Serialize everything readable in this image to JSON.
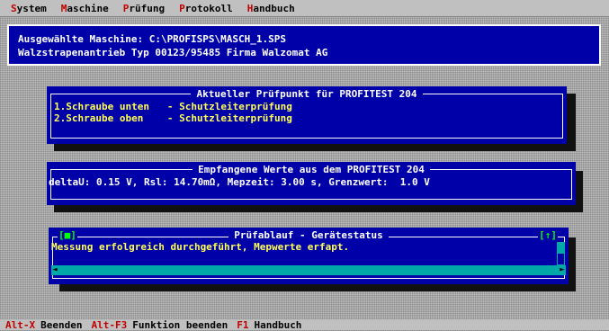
{
  "menu": [
    {
      "hot": "S",
      "rest": "ystem"
    },
    {
      "hot": "M",
      "rest": "aschine"
    },
    {
      "hot": "P",
      "rest": "rüfung"
    },
    {
      "hot": "P",
      "rest": "rotokoll"
    },
    {
      "hot": "H",
      "rest": "andbuch"
    }
  ],
  "machine": {
    "line1": "Ausgewählte Maschine: C:\\PROFISPS\\MASCH_1.SPS",
    "line2": "Walzstrapenantrieb Typ 00123/95485 Firma Walzomat AG"
  },
  "pruefpunkt": {
    "title": "Aktueller Prüfpunkt für PROFITEST 204",
    "rows": [
      "1.Schraube unten   - Schutzleiterprüfung",
      "2.Schraube oben    - Schutzleiterprüfung"
    ]
  },
  "werte": {
    "title": "Empfangene Werte aus dem PROFITEST 204",
    "line": "deltaU: 0.15 V, Rsl: 14.70mΩ, Mepzeit: 3.00 s, Grenzwert:  1.0 V"
  },
  "status": {
    "title": "Prüfablauf - Gerätestatus",
    "close": "[■]",
    "maximize": "[↑]",
    "message": "Messung erfolgreich durchgeführt, Mepwerte erfapt."
  },
  "statusbar": [
    {
      "key": "Alt-X",
      "label": "Beenden"
    },
    {
      "key": "Alt-F3",
      "label": "Funktion beenden"
    },
    {
      "key": "F1",
      "label": "Handbuch"
    }
  ],
  "colors": {
    "panel": "#0000a8",
    "text_highlight": "#ffff55",
    "hotkey": "#c00000",
    "scroll": "#00a8a8"
  }
}
